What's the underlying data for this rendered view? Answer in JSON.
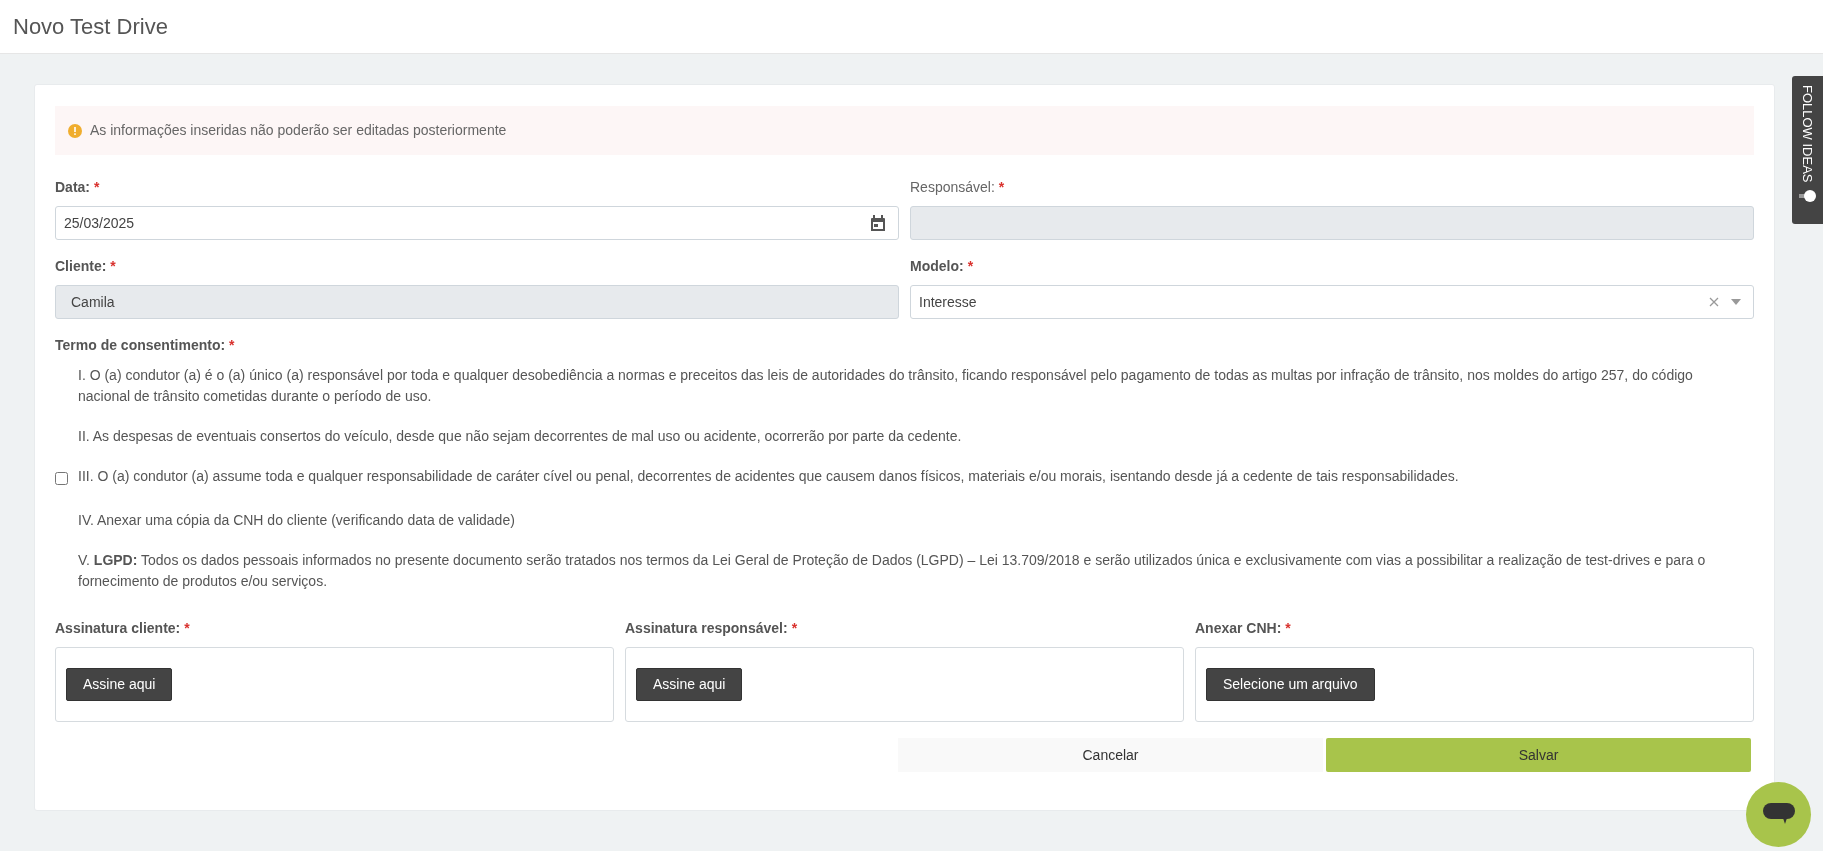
{
  "page": {
    "title": "Novo Test Drive"
  },
  "alert": {
    "text": "As informações inseridas não poderão ser editadas posteriormente"
  },
  "fields": [
    {
      "label": "Data:",
      "label_bold": true,
      "required_mark": "*",
      "kind": "date",
      "value": "25/03/2025",
      "disabled": false
    },
    {
      "label": "Responsável:",
      "label_bold": false,
      "required_mark": "*",
      "kind": "text",
      "disabled": true
    },
    {
      "label": "Cliente:",
      "label_bold": true,
      "required_mark": "*",
      "kind": "text",
      "value": "Camila",
      "disabled": true
    },
    {
      "label": "Modelo:",
      "label_bold": true,
      "required_mark": "*",
      "kind": "select",
      "value": "Interesse",
      "disabled": false
    }
  ],
  "consent": {
    "label": "Termo de consentimento:",
    "required_mark": "*",
    "items": [
      {
        "kind": "text",
        "text": "I. O (a) condutor (a) é o (a) único (a) responsável por toda e qualquer desobediência a normas e preceitos das leis de autoridades do trânsito, ficando responsável pelo pagamento de todas as multas por infração de trânsito, nos moldes do artigo 257, do código nacional de trânsito cometidas durante o período de uso."
      },
      {
        "kind": "text",
        "text": "II. As despesas de eventuais consertos do veículo, desde que não sejam decorrentes de mal uso ou acidente, ocorrerão por parte da cedente."
      },
      {
        "kind": "checkbox",
        "checked": false,
        "text": "III. O (a) condutor (a) assume toda e qualquer responsabilidade de caráter cível ou penal, decorrentes de acidentes que causem danos físicos, materiais e/ou morais, isentando desde já a cedente de tais responsabilidades."
      },
      {
        "kind": "text",
        "text": "IV. Anexar uma cópia da CNH do cliente (verificando data de validade)"
      },
      {
        "kind": "text",
        "text": "V. **LGPD:** Todos os dados pessoais informados no presente documento serão tratados nos termos da Lei Geral de Proteção de Dados (LGPD) – Lei 13.709/2018 e serão utilizados única e exclusivamente com vias a possibilitar a realização de test-drives e para o fornecimento de produtos e/ou serviços."
      }
    ]
  },
  "uploads": [
    {
      "label": "Assinatura cliente:",
      "required_mark": "*",
      "button": "Assine aqui"
    },
    {
      "label": "Assinatura responsável:",
      "required_mark": "*",
      "button": "Assine aqui"
    },
    {
      "label": "Anexar CNH:",
      "required_mark": "*",
      "button": "Selecione um arquivo"
    }
  ],
  "actions": {
    "cancel": "Cancelar",
    "save": "Salvar"
  },
  "side_tab": {
    "text": "FOLLOW IDEAS"
  }
}
